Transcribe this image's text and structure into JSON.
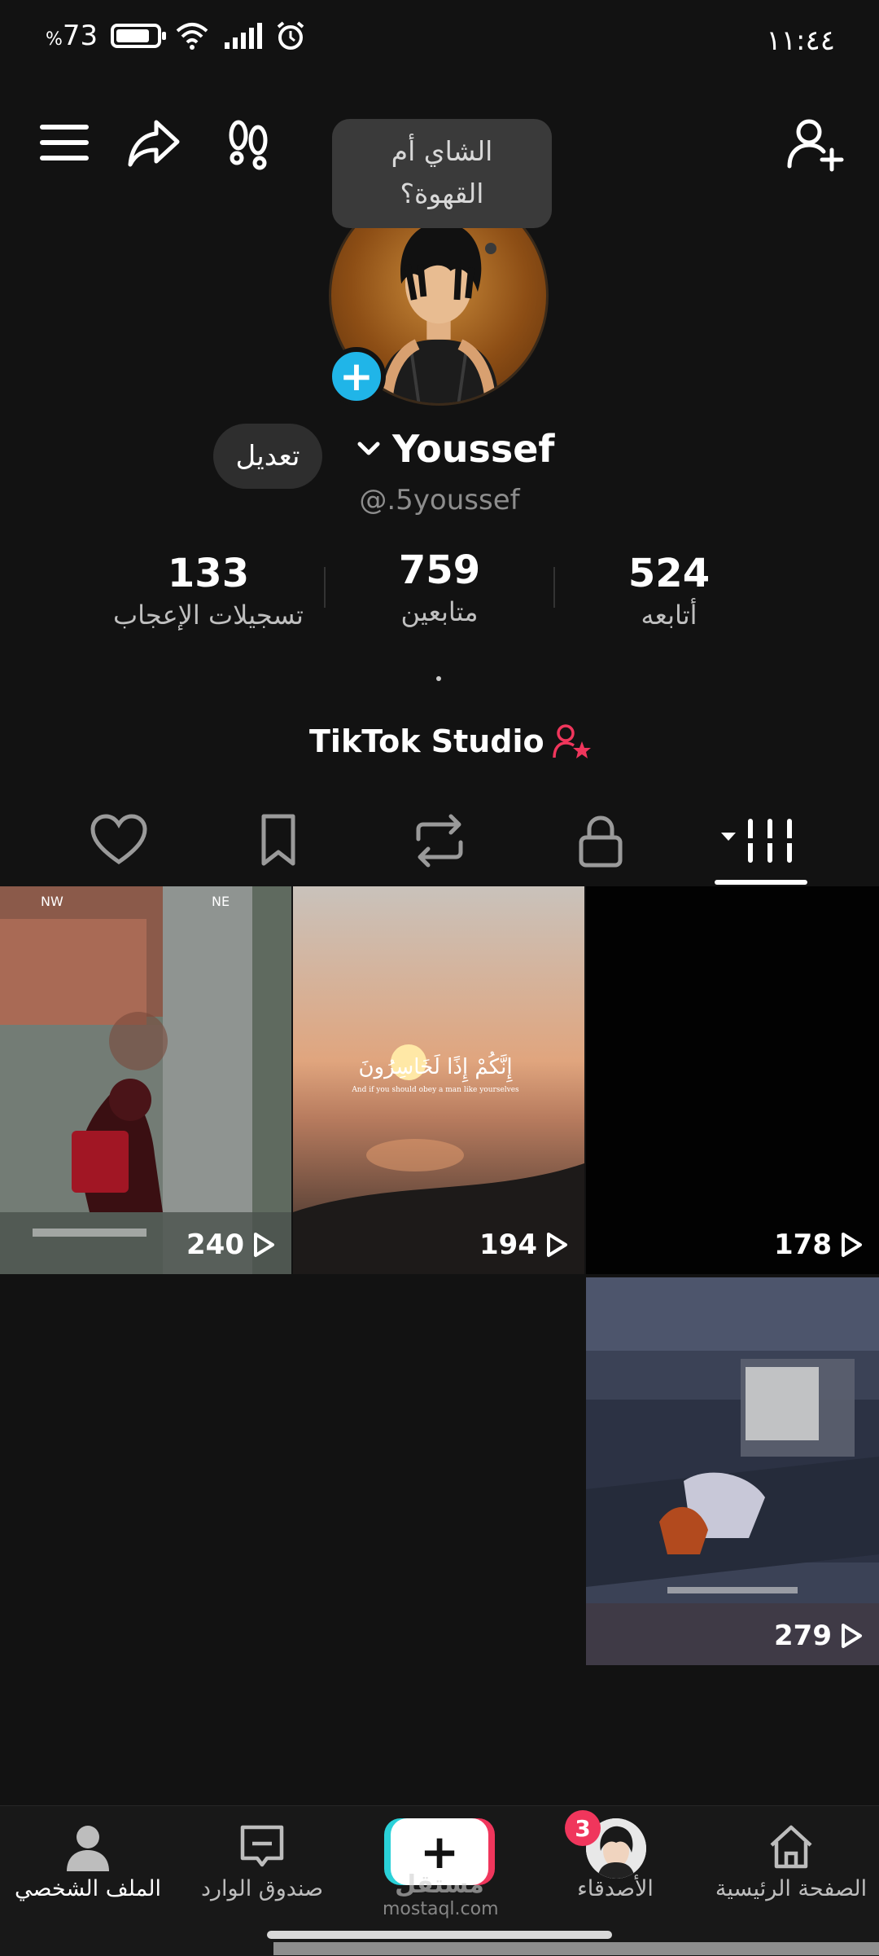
{
  "status_bar": {
    "battery": "73",
    "battery_prefix": "%",
    "time": "١١:٤٤"
  },
  "header": {
    "tooltip": [
      "الشاي أم",
      "القهوة؟"
    ]
  },
  "profile": {
    "name": "Youssef",
    "handle": "@.5youssef",
    "edit_label": "تعديل",
    "stats": [
      {
        "value": "133",
        "label": "تسجيلات الإعجاب"
      },
      {
        "value": "759",
        "label": "متابعين"
      },
      {
        "value": "524",
        "label": "أتابعه"
      }
    ],
    "studio": "TikTok Studio"
  },
  "tabs": [
    "videos-grid-icon",
    "lock-icon",
    "repost-icon",
    "bookmark-icon",
    "heart-icon"
  ],
  "videos": [
    {
      "views": "240",
      "thumb": "pubg-1"
    },
    {
      "views": "194",
      "thumb": "sunset",
      "overlay_ar": "إِنَّكُمْ إِذًا لَخَاسِرُونَ",
      "overlay_en": "And if you should obey a man like yourselves"
    },
    {
      "views": "178",
      "thumb": "black"
    },
    {
      "views": "279",
      "thumb": "pubg-2"
    }
  ],
  "bottom_nav": {
    "home": "الصفحة الرئيسية",
    "friends": "الأصدقاء",
    "friends_badge": "3",
    "inbox": "صندوق الوارد",
    "profile": "الملف الشخصي",
    "watermark_ar": "مستقل",
    "watermark": "mostaql.com"
  },
  "colors": {
    "accent_blue": "#20b5e8",
    "accent_red": "#f0365c",
    "accent_cyan": "#2ad1d8",
    "background": "#121212"
  }
}
